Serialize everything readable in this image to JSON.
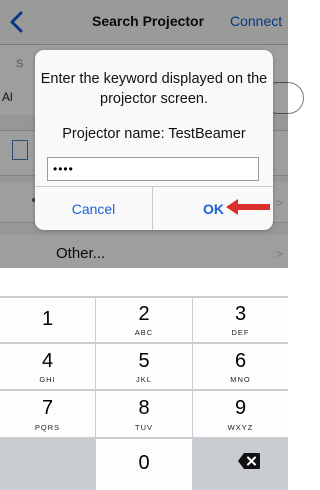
{
  "navbar": {
    "title": "Search Projector",
    "connect_label": "Connect"
  },
  "background": {
    "row1_partial_label": "S",
    "row1_partial_value": "Al",
    "other_label": "Other...",
    "chevron": ">"
  },
  "alert": {
    "message": "Enter the keyword displayed on the projector screen.",
    "projector_name": "Projector name: TestBeamer",
    "keyword_value": "••••",
    "cancel_label": "Cancel",
    "ok_label": "OK"
  },
  "keypad": {
    "keys": [
      {
        "num": "1",
        "letters": ""
      },
      {
        "num": "2",
        "letters": "ABC"
      },
      {
        "num": "3",
        "letters": "DEF"
      },
      {
        "num": "4",
        "letters": "GHI"
      },
      {
        "num": "5",
        "letters": "JKL"
      },
      {
        "num": "6",
        "letters": "MNO"
      },
      {
        "num": "7",
        "letters": "PQRS"
      },
      {
        "num": "8",
        "letters": "TUV"
      },
      {
        "num": "9",
        "letters": "WXYZ"
      },
      {
        "num": "0",
        "letters": ""
      }
    ]
  },
  "colors": {
    "accent": "#1a61d6",
    "annotation_arrow": "#d9302b",
    "keypad_bg": "#c9ccd1"
  },
  "icons": {
    "back": "chevron-left-icon",
    "delete": "backspace-icon",
    "annotation": "red-arrow-icon"
  }
}
